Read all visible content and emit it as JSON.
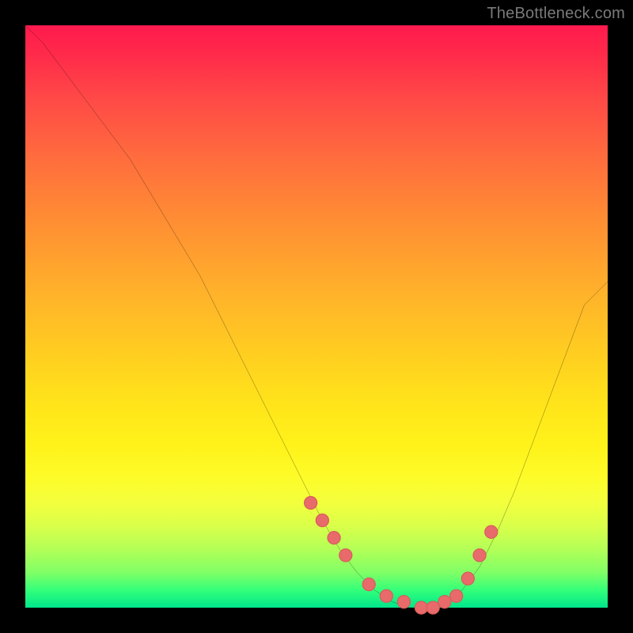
{
  "watermark": "TheBottleneck.com",
  "colors": {
    "curve_stroke": "#000000",
    "marker_fill": "#e86a6a",
    "marker_stroke": "#d85a5a",
    "gradient_top": "#ff1a4d",
    "gradient_bottom": "#00e68a",
    "background": "#000000"
  },
  "chart_data": {
    "type": "line",
    "title": "",
    "xlabel": "",
    "ylabel": "",
    "xlim": [
      0,
      100
    ],
    "ylim": [
      0,
      100
    ],
    "grid": false,
    "legend": false,
    "series": [
      {
        "name": "bottleneck-curve",
        "x": [
          0,
          3,
          6,
          9,
          12,
          15,
          18,
          21,
          24,
          27,
          30,
          33,
          36,
          39,
          42,
          45,
          48,
          51,
          54,
          57,
          60,
          63,
          66,
          69,
          72,
          75,
          78,
          81,
          84,
          87,
          90,
          93,
          96,
          100
        ],
        "values": [
          100,
          97,
          93,
          89,
          85,
          81,
          77,
          72,
          67,
          62,
          57,
          51,
          45,
          39,
          33,
          27,
          21,
          15,
          10,
          6,
          3,
          1,
          0,
          0,
          1,
          3,
          7,
          13,
          20,
          28,
          36,
          44,
          52,
          56
        ]
      }
    ],
    "markers": {
      "name": "sample-points",
      "x": [
        49,
        51,
        53,
        55,
        59,
        62,
        65,
        68,
        70,
        72,
        74,
        76,
        78,
        80
      ],
      "values": [
        18,
        15,
        12,
        9,
        4,
        2,
        1,
        0,
        0,
        1,
        2,
        5,
        9,
        13
      ]
    }
  }
}
